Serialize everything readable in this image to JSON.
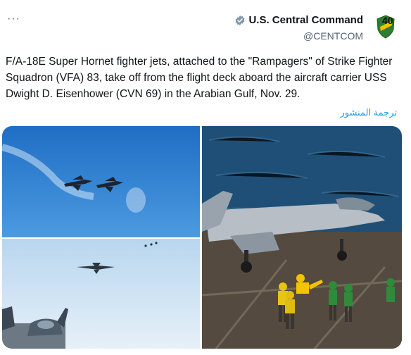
{
  "header": {
    "more_label": "···",
    "display_name": "U.S. Central Command",
    "handle": "@CENTCOM",
    "avatar_text": "40"
  },
  "tweet": {
    "text": "F/A-18E Super Hornet fighter jets, attached to the \"Rampagers\" of Strike Fighter Squadron (VFA) 83, take off from the flight deck aboard the aircraft carrier USS Dwight D. Eisenhower (CVN 69) in the Arabian Gulf, Nov. 29.",
    "translate_label": "ترجمة المنشور"
  },
  "colors": {
    "verified": "#829aab",
    "link": "#1d9bf0",
    "sky": "#2f7fd0",
    "sea": "#1f4f76"
  }
}
